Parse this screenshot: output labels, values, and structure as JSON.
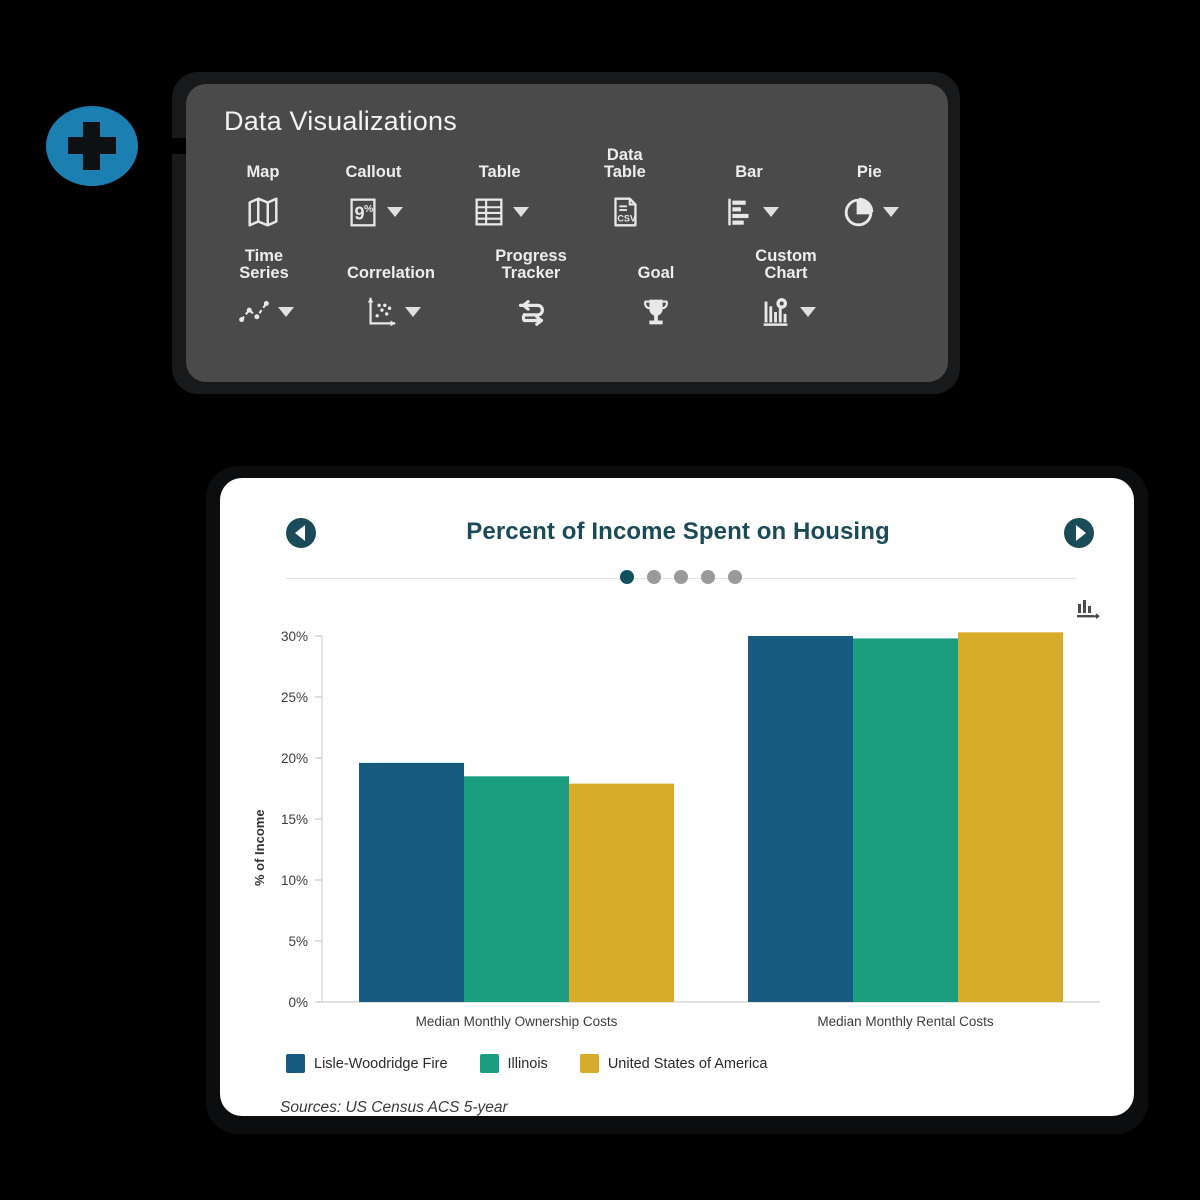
{
  "toolbar": {
    "title": "Data Visualizations",
    "add_button": {
      "name": "add-visualization-button",
      "icon": "plus-icon",
      "color": "#1b7fb2"
    },
    "background_color": "#4a4a4a",
    "rows": [
      [
        {
          "label": "Map",
          "icon": "map-icon",
          "has_dropdown": false
        },
        {
          "label": "Callout",
          "icon": "percent-callout-icon",
          "has_dropdown": true
        },
        {
          "label": "Table",
          "icon": "table-grid-icon",
          "has_dropdown": true
        },
        {
          "label": "Data\nTable",
          "icon": "csv-file-icon",
          "has_dropdown": false
        },
        {
          "label": "Bar",
          "icon": "horizontal-bar-chart-icon",
          "has_dropdown": true
        },
        {
          "label": "Pie",
          "icon": "pie-chart-icon",
          "has_dropdown": true
        }
      ],
      [
        {
          "label": "Time\nSeries",
          "icon": "line-series-icon",
          "has_dropdown": true
        },
        {
          "label": "Correlation",
          "icon": "scatter-plot-icon",
          "has_dropdown": true
        },
        {
          "label": "Progress\nTracker",
          "icon": "progress-arrows-icon",
          "has_dropdown": false
        },
        {
          "label": "Goal",
          "icon": "trophy-icon",
          "has_dropdown": false
        },
        {
          "label": "Custom\nChart",
          "icon": "custom-chart-gear-icon",
          "has_dropdown": true
        }
      ]
    ]
  },
  "card": {
    "prev_label": "Previous",
    "next_label": "Next",
    "export_icon": "bar-chart-export-icon",
    "pagination": {
      "count": 5,
      "active_index": 0
    },
    "sources": "Sources: US Census ACS 5-year"
  },
  "chart_data": {
    "type": "bar",
    "title": "Percent of Income Spent on Housing",
    "xlabel": "",
    "ylabel": "% of Income",
    "ylim": [
      0,
      30
    ],
    "yticks": [
      0,
      5,
      10,
      15,
      20,
      25,
      30
    ],
    "ytick_labels": [
      "0%",
      "5%",
      "10%",
      "15%",
      "20%",
      "25%",
      "30%"
    ],
    "grid": false,
    "legend_position": "bottom-left",
    "categories": [
      "Median Monthly Ownership Costs",
      "Median Monthly Rental Costs"
    ],
    "series": [
      {
        "name": "Lisle-Woodridge Fire",
        "color": "#175b81",
        "values": [
          19.6,
          30.0
        ]
      },
      {
        "name": "Illinois",
        "color": "#1b9e7f",
        "values": [
          18.5,
          29.8
        ]
      },
      {
        "name": "United States of America",
        "color": "#d6ac28",
        "values": [
          17.9,
          30.3
        ]
      }
    ],
    "source_note": "Sources: US Census ACS 5-year"
  }
}
